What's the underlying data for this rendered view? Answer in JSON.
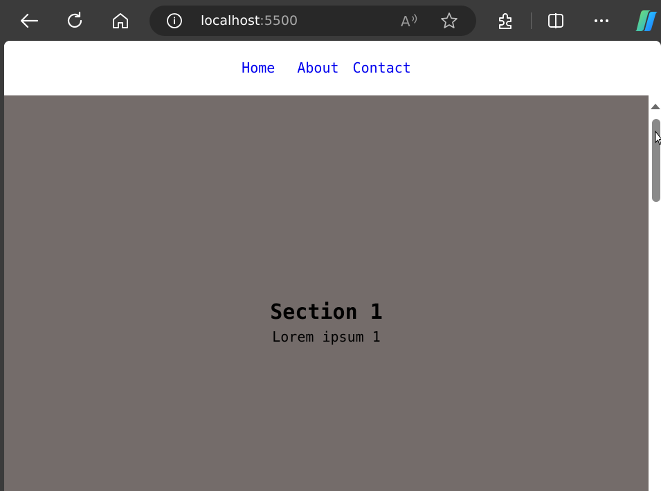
{
  "browser": {
    "address": {
      "host": "localhost",
      "port": ":5500"
    },
    "icons": {
      "back": "back-arrow-icon",
      "refresh": "refresh-icon",
      "home": "home-icon",
      "info": "site-info-icon",
      "read_aloud": "read-aloud-icon",
      "favorite": "favorite-star-icon",
      "extensions": "extensions-puzzle-icon",
      "split_screen": "split-screen-icon",
      "more": "more-options-icon",
      "copilot": "copilot-icon"
    }
  },
  "page": {
    "nav": {
      "items": [
        {
          "label": "Home"
        },
        {
          "label": "About"
        },
        {
          "label": "Contact"
        }
      ]
    },
    "section": {
      "title": "Section 1",
      "text": "Lorem ipsum 1",
      "background": "#746c6a"
    },
    "colors": {
      "link": "#0000ee",
      "toolbar": "#3b3b3b",
      "address_bar": "#282828"
    }
  }
}
